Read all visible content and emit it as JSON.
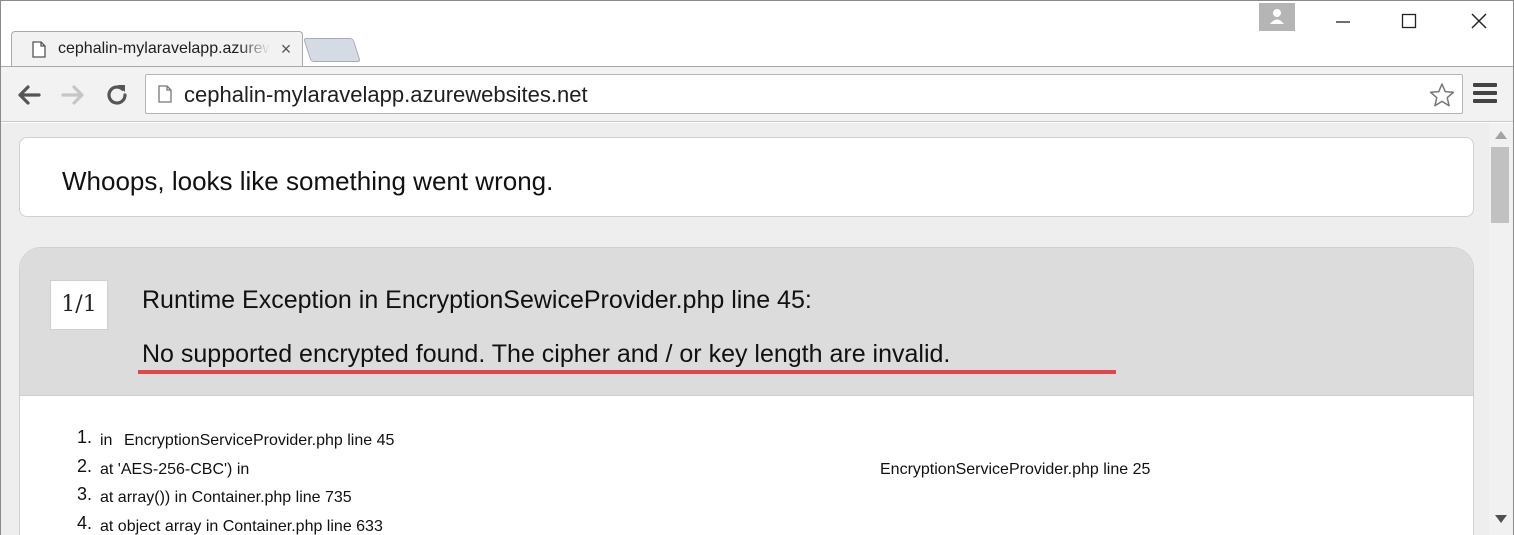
{
  "browser": {
    "tab": {
      "title": "cephalin-mylaravelapp.azurewebsites.net",
      "favicon": "page-icon",
      "close": "×"
    },
    "window_controls": [
      "minimize-icon",
      "maximize-icon",
      "close-icon"
    ],
    "toolbar": {
      "url": "cephalin-mylaravelapp.azurewebsites.net",
      "icons": [
        "back-arrow-icon",
        "forward-arrow-icon",
        "reload-icon",
        "star-icon",
        "menu-icon"
      ]
    }
  },
  "page": {
    "whoops": "Whoops, looks like something went wrong.",
    "exception": {
      "counter": "1/1",
      "title": "Runtime Exception in EncryptionSewiceProvider.php line 45:",
      "message": "No supported encrypted found. The cipher and / or key length are invalid.",
      "highlight_color": "#e0474c"
    },
    "trace": [
      {
        "num": "1.",
        "prefix": "in",
        "text": "EncryptionServiceProvider.php line 45",
        "right": ""
      },
      {
        "num": "2.",
        "prefix": "",
        "text": "at 'AES-256-CBC') in",
        "right": "EncryptionServiceProvider.php line 25"
      },
      {
        "num": "3.",
        "prefix": "",
        "text": "at array()) in Container.php line 735",
        "right": ""
      },
      {
        "num": "4.",
        "prefix": "",
        "text": "at object array in Container.php line 633",
        "right": ""
      }
    ]
  }
}
